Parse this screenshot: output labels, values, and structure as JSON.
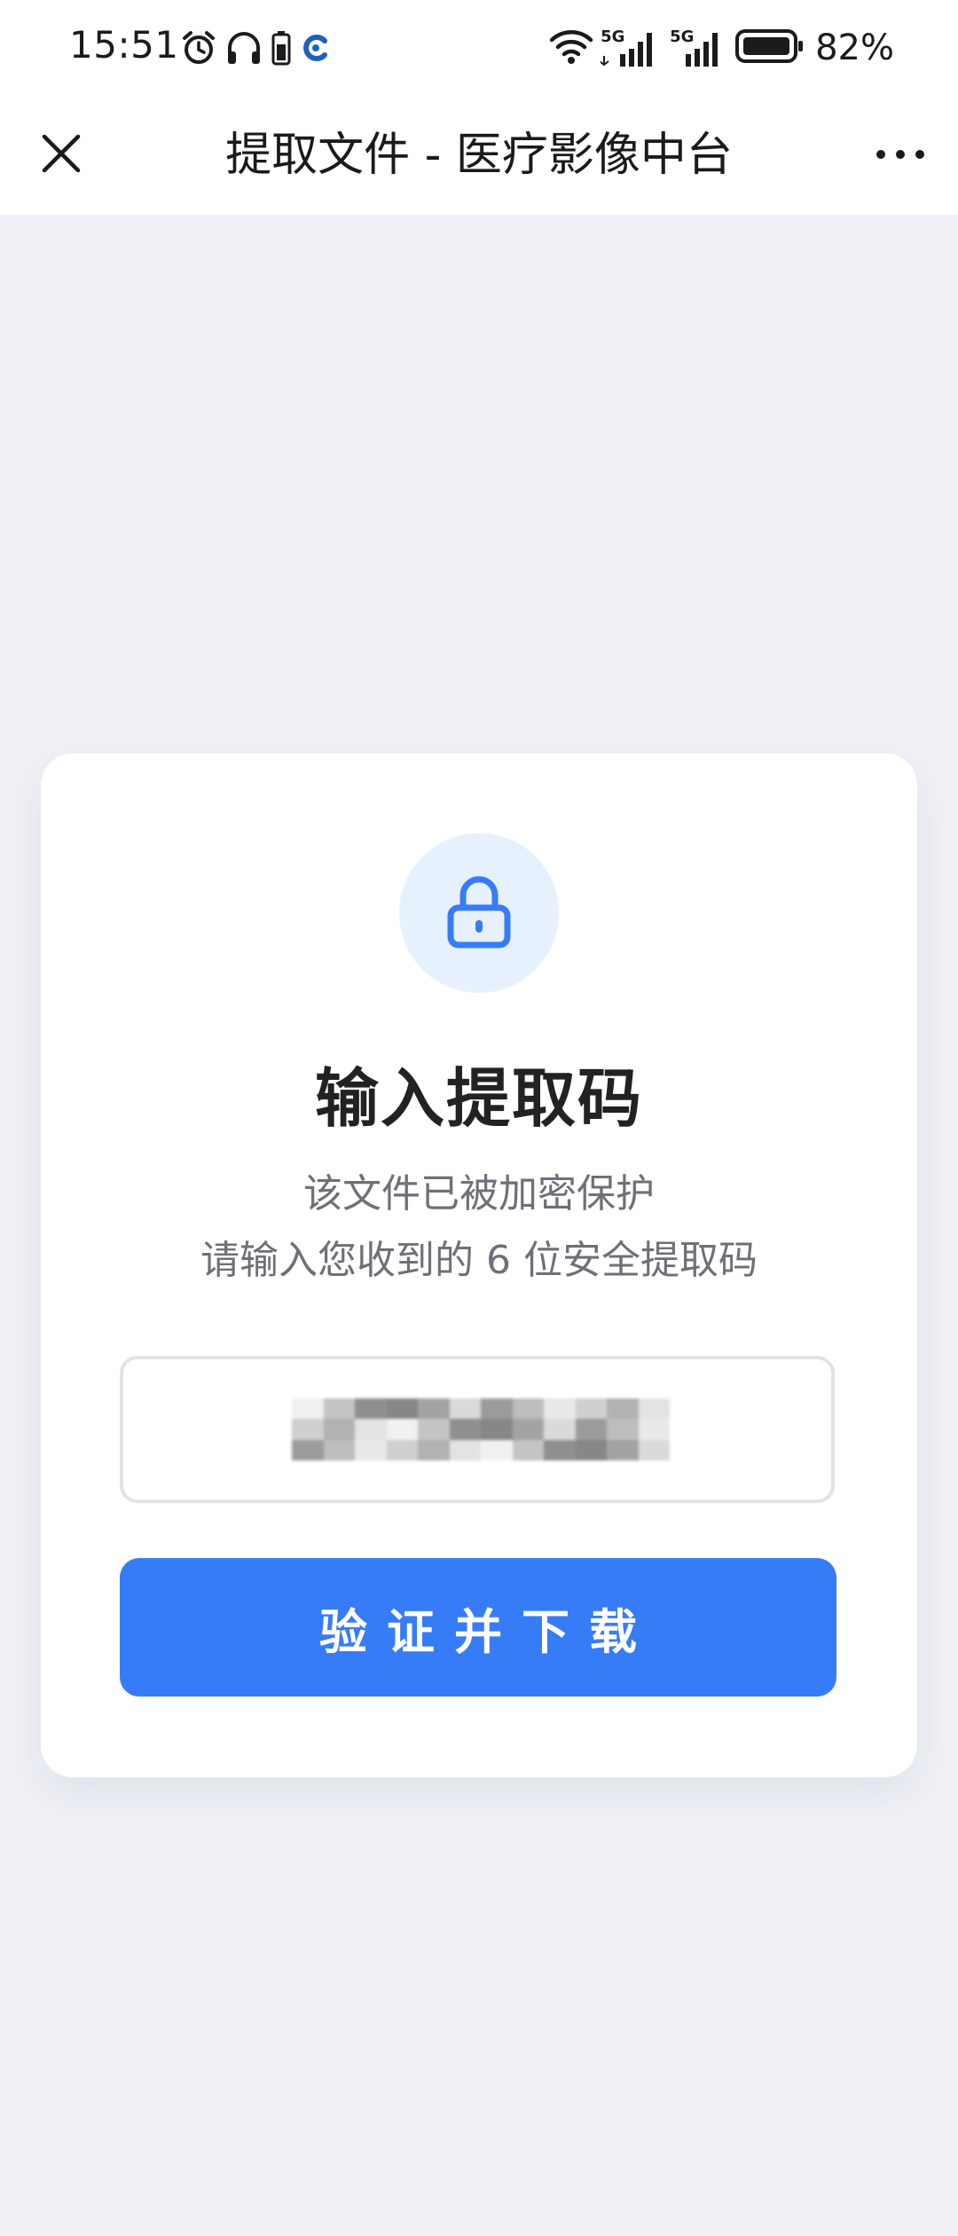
{
  "status_bar": {
    "time": "15:51",
    "battery_percent": "82%",
    "network_1": "5G",
    "network_2": "5G",
    "icons": [
      "alarm-icon",
      "headphones-icon",
      "battery-small-icon",
      "app-notification-icon",
      "wifi-icon",
      "signal-icon",
      "signal-icon",
      "battery-icon"
    ]
  },
  "title_bar": {
    "title": "提取文件 - 医疗影像中台",
    "close_icon": "close-icon",
    "more_icon": "more-icon"
  },
  "card": {
    "icon": "lock-icon",
    "heading": "输入提取码",
    "subtitle_line1": "该文件已被加密保护",
    "subtitle_line2": "请输入您收到的 6 位安全提取码",
    "input_value": "",
    "submit_label": "验证并下载"
  },
  "colors": {
    "page_background": "#eff1f6",
    "accent": "#367cf6",
    "lock_circle_bg": "#e7f1fe",
    "subtitle_text": "#6e7079"
  }
}
